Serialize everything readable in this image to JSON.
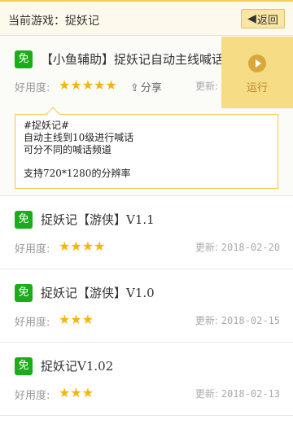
{
  "header": {
    "current_game": "当前游戏：捉妖记",
    "back_label": "返回"
  },
  "labels": {
    "free_badge": "免",
    "rating_label": "好用度:",
    "share_label": "分享",
    "update_prefix": "更新:",
    "run_label": "运行"
  },
  "scripts": [
    {
      "title": "【小鱼辅助】捉妖记自动主线喊话",
      "rating": 5,
      "update_date": "",
      "expanded": true,
      "description": [
        "#捉妖记#",
        "自动主线到10级进行喊话",
        "可分不同的喊话频道",
        "",
        "支持720*1280的分辨率"
      ]
    },
    {
      "title": "捉妖记【游侠】V1.1",
      "rating": 4,
      "update_date": "2018-02-20"
    },
    {
      "title": "捉妖记【游侠】V1.0",
      "rating": 3,
      "update_date": "2018-02-15"
    },
    {
      "title": "捉妖记V1.02",
      "rating": 3,
      "update_date": "2018-02-13"
    }
  ],
  "colors": {
    "accent_yellow": "#f7dc86",
    "badge_green": "#1aad19",
    "star": "#f5b50a"
  }
}
